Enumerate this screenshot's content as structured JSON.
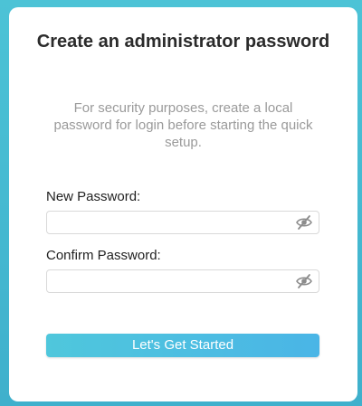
{
  "dialog": {
    "title": "Create an administrator password",
    "subtitle": "For security purposes, create a local password for login before starting the quick setup."
  },
  "fields": {
    "new_password": {
      "label": "New Password:",
      "value": "",
      "placeholder": ""
    },
    "confirm_password": {
      "label": "Confirm Password:",
      "value": "",
      "placeholder": ""
    }
  },
  "button": {
    "label": "Let's Get Started"
  },
  "icons": {
    "visibility_toggle": "eye-slash-icon"
  },
  "colors": {
    "background": "#45bbd2",
    "button_start": "#4fc7dc",
    "button_end": "#4ab5e6",
    "subtitle": "#9a9a9a"
  }
}
